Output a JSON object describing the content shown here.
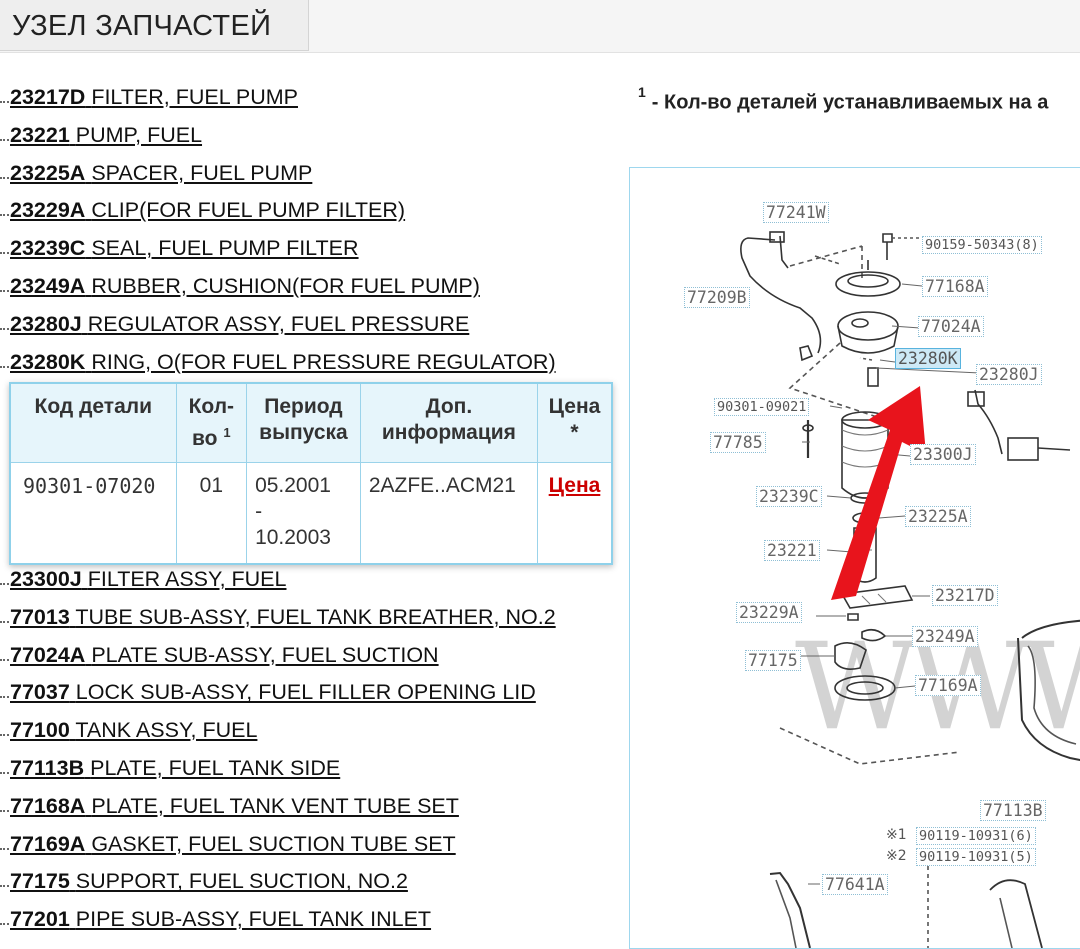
{
  "header": {
    "title": "УЗЕЛ ЗАПЧАСТЕЙ"
  },
  "parts_before": [
    {
      "code": "23217D",
      "name": "FILTER, FUEL PUMP"
    },
    {
      "code": "23221",
      "name": "PUMP, FUEL"
    },
    {
      "code": "23225A",
      "name": "SPACER, FUEL PUMP"
    },
    {
      "code": "23229A",
      "name": "CLIP(FOR FUEL PUMP FILTER)"
    },
    {
      "code": "23239C",
      "name": "SEAL, FUEL PUMP FILTER"
    },
    {
      "code": "23249A",
      "name": "RUBBER, CUSHION(FOR FUEL PUMP)"
    },
    {
      "code": "23280J",
      "name": "REGULATOR ASSY, FUEL PRESSURE"
    },
    {
      "code": "23280K",
      "name": "RING, O(FOR FUEL PRESSURE REGULATOR)"
    }
  ],
  "detail_table": {
    "headers": {
      "code": "Код детали",
      "qty_line1": "Кол-",
      "qty_line2": "во",
      "qty_sup": "1",
      "period_line1": "Период",
      "period_line2": "выпуска",
      "info_line1": "Доп.",
      "info_line2": "информация",
      "price_line1": "Цена",
      "price_line2": "*"
    },
    "row": {
      "code": "90301-07020",
      "qty": "01",
      "period_from": "05.2001",
      "period_dash": "-",
      "period_to": "10.2003",
      "info": "2AZFE..ACM21",
      "price_link": "Цена"
    }
  },
  "parts_after": [
    {
      "code": "23300J",
      "name": "FILTER ASSY, FUEL"
    },
    {
      "code": "77013",
      "name": "TUBE SUB-ASSY, FUEL TANK BREATHER, NO.2"
    },
    {
      "code": "77024A",
      "name": "PLATE SUB-ASSY, FUEL SUCTION"
    },
    {
      "code": "77037",
      "name": "LOCK SUB-ASSY, FUEL FILLER OPENING LID"
    },
    {
      "code": "77100",
      "name": "TANK ASSY, FUEL"
    },
    {
      "code": "77113B",
      "name": "PLATE, FUEL TANK SIDE"
    },
    {
      "code": "77168A",
      "name": "PLATE, FUEL TANK VENT TUBE SET"
    },
    {
      "code": "77169A",
      "name": "GASKET, FUEL SUCTION TUBE SET"
    },
    {
      "code": "77175",
      "name": "SUPPORT, FUEL SUCTION, NO.2"
    },
    {
      "code": "77201",
      "name": "PIPE SUB-ASSY, FUEL TANK INLET"
    }
  ],
  "footnote": {
    "sup": "1",
    "text": "- Кол-во деталей устанавливаемых на а"
  },
  "diagram": {
    "callouts": {
      "c77241W": "77241W",
      "c90159": "90159-50343(8)",
      "c77209B": "77209B",
      "c77168A": "77168A",
      "c77024A": "77024A",
      "c23280K": "23280K",
      "c23280J": "23280J",
      "c90301": "90301-09021",
      "c77785": "77785",
      "c23300J": "23300J",
      "c23239C": "23239C",
      "c23225A": "23225A",
      "c23221": "23221",
      "c23217D": "23217D",
      "c23229A": "23229A",
      "c23249A": "23249A",
      "c77175": "77175",
      "c77169A": "77169A",
      "c77113B": "77113B",
      "c90119a": "90119-10931(6)",
      "c90119b": "90119-10931(5)",
      "c77641A": "77641A",
      "note1": "※1",
      "note2": "※2"
    },
    "watermark": "WWW",
    "colors": {
      "arrow": "#e8141c",
      "highlight": "#cde9f6",
      "frame": "#9ed7ee"
    }
  }
}
